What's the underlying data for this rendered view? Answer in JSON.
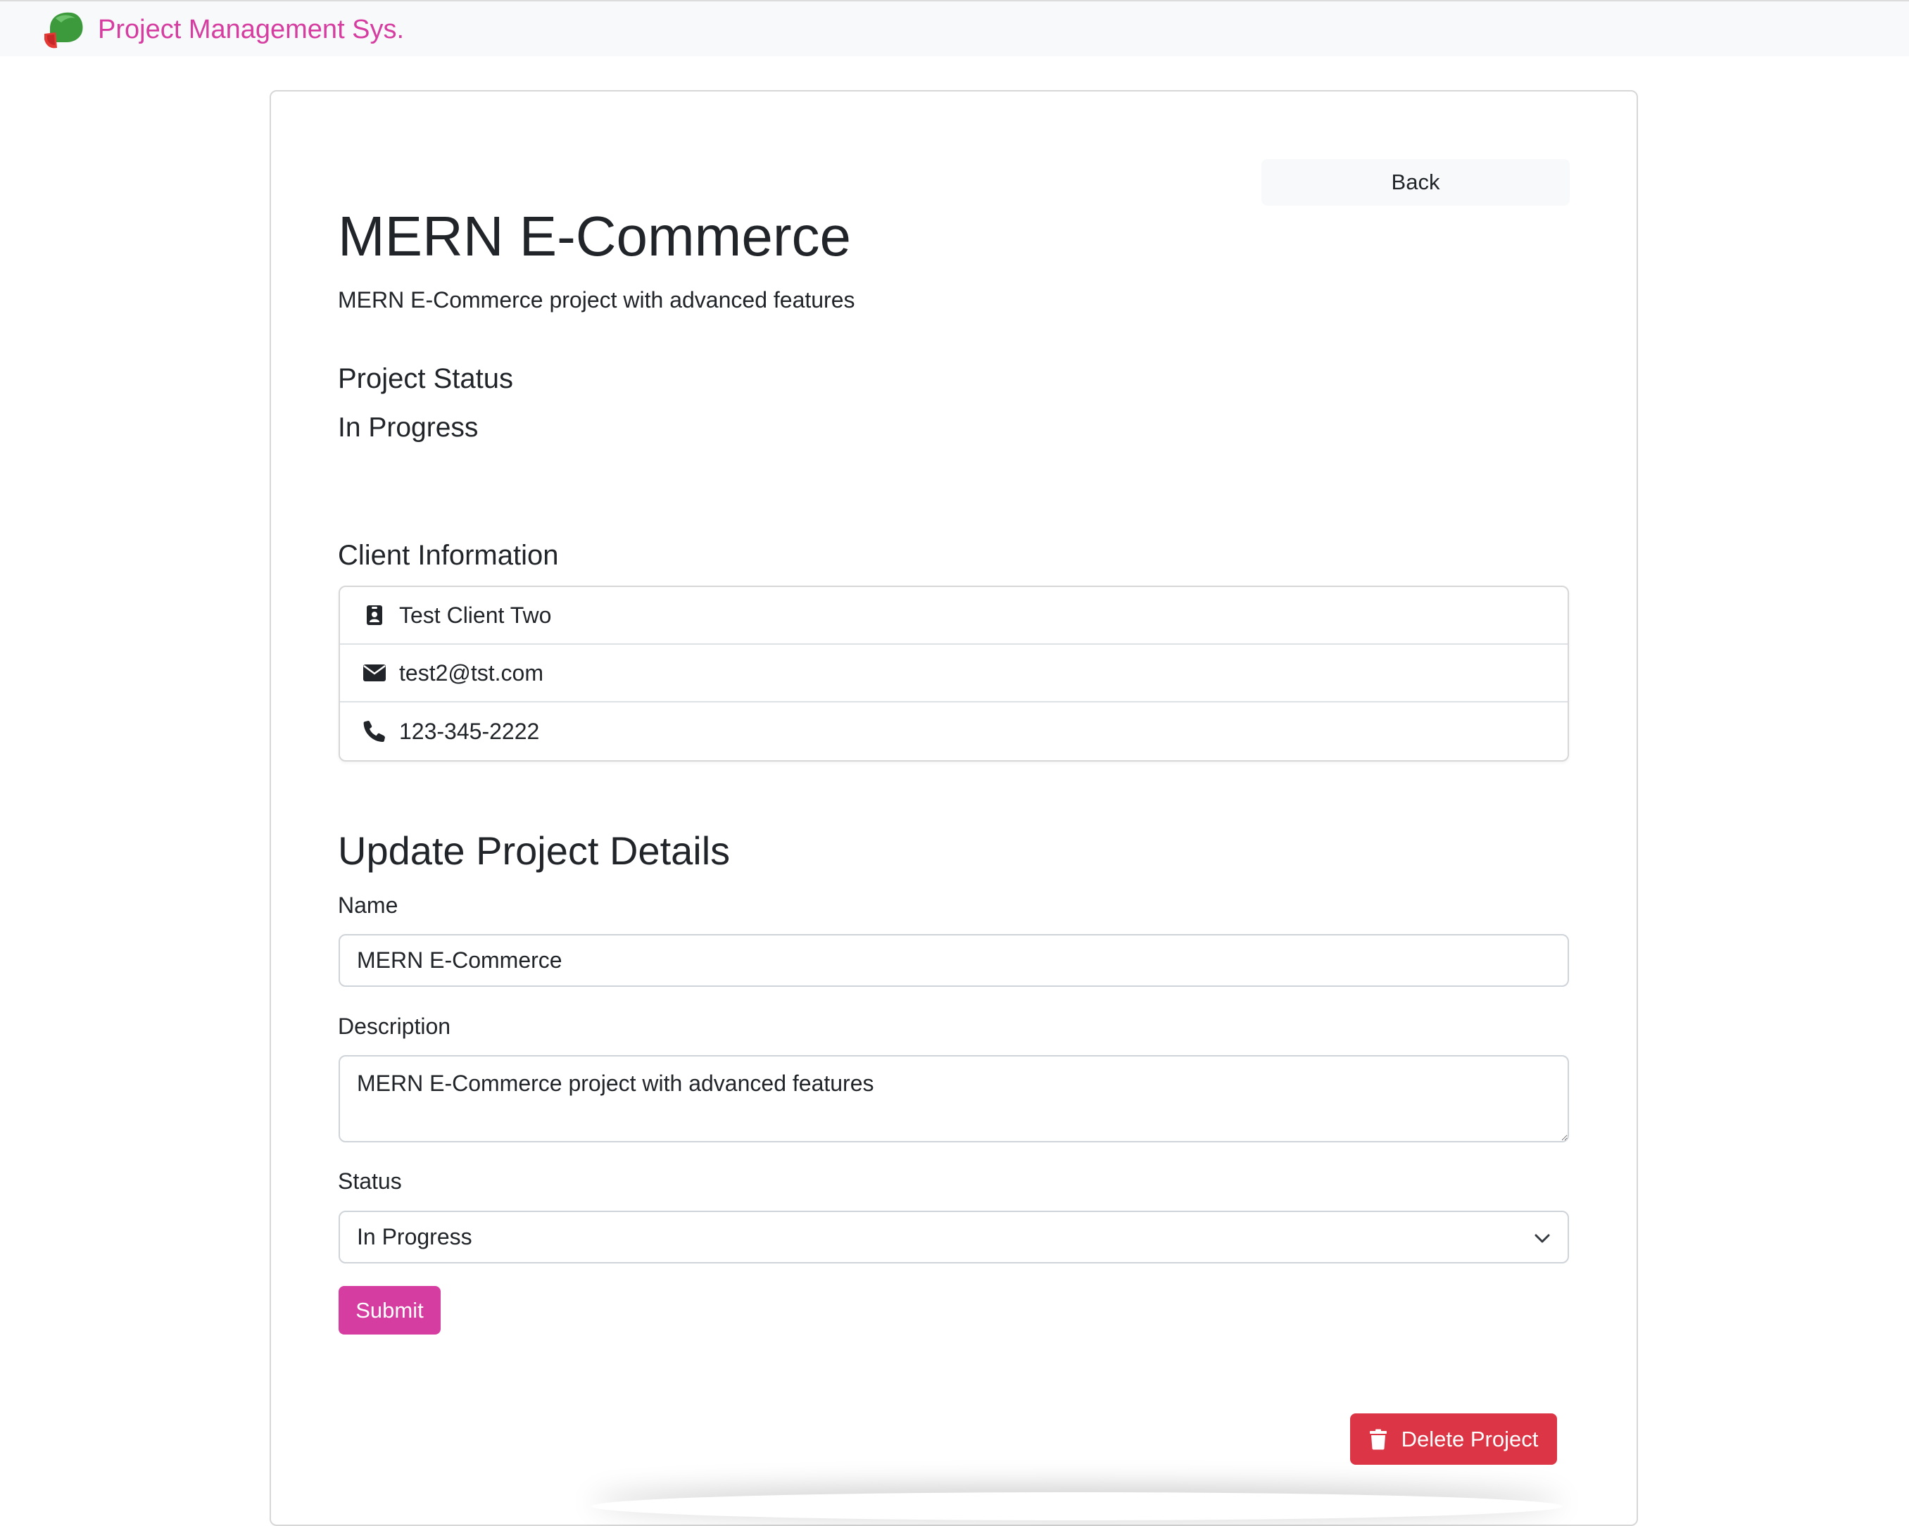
{
  "navbar": {
    "brand_text": "Project Management Sys."
  },
  "back_button": "Back",
  "project": {
    "name": "MERN E-Commerce",
    "description": "MERN E-Commerce project with advanced features",
    "status_heading": "Project Status",
    "status": "In Progress"
  },
  "client": {
    "heading": "Client Information",
    "name": "Test Client Two",
    "email": "test2@tst.com",
    "phone": "123-345-2222",
    "icons": [
      "id-badge-icon",
      "envelope-icon",
      "phone-icon"
    ]
  },
  "form": {
    "heading": "Update Project Details",
    "name_label": "Name",
    "name_value": "MERN E-Commerce",
    "description_label": "Description",
    "description_value": "MERN E-Commerce project with advanced features",
    "status_label": "Status",
    "status_value": "In Progress",
    "submit_label": "Submit"
  },
  "delete_button": "Delete Project",
  "colors": {
    "brand": "#d63da0",
    "danger": "#dc3545",
    "navbar_bg": "#f8f9fa",
    "text": "#212529"
  }
}
